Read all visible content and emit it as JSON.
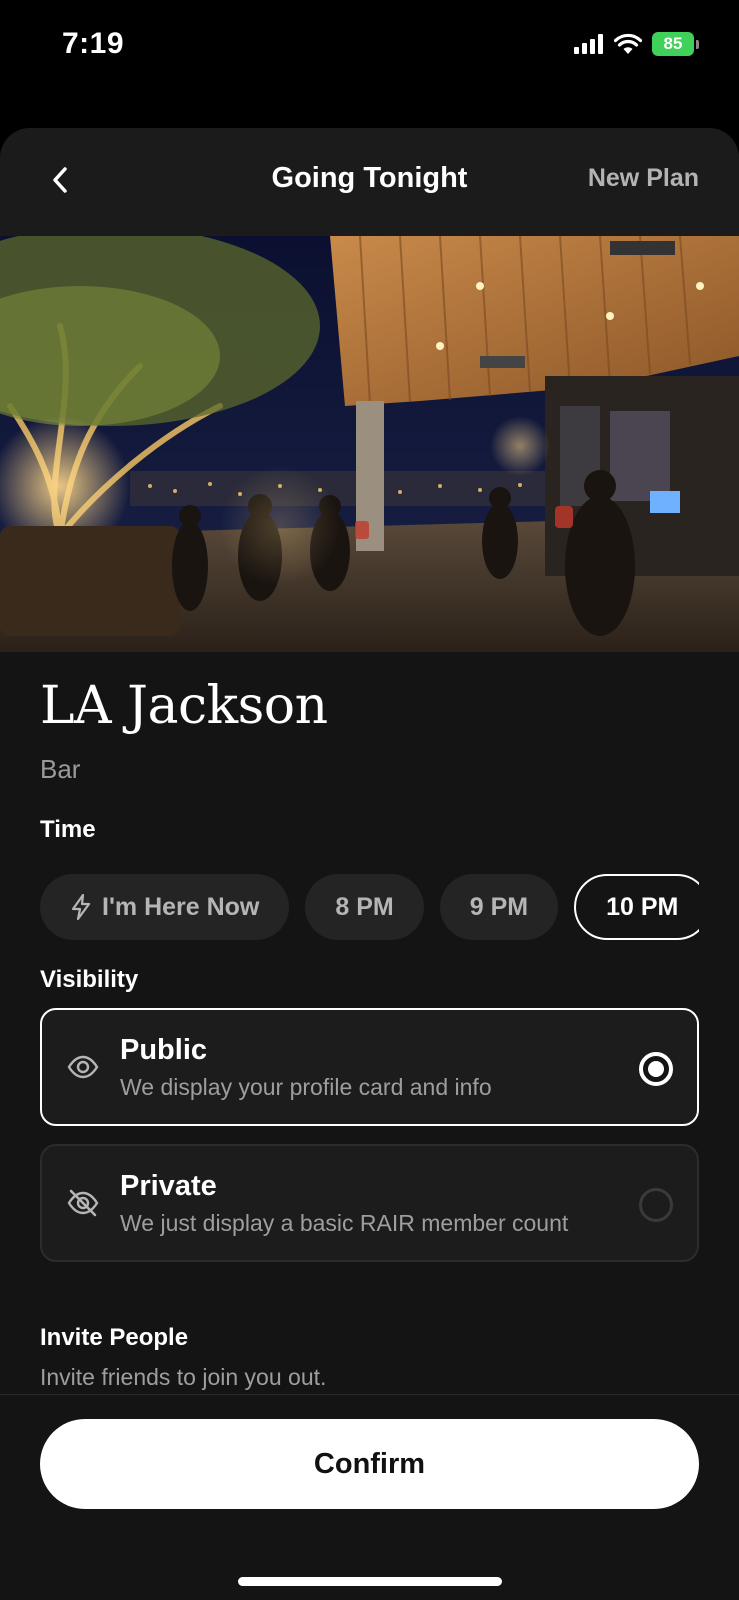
{
  "status_bar": {
    "time": "7:19",
    "battery": "85",
    "icons": [
      "cellular-signal-icon",
      "wifi-icon",
      "battery-icon"
    ]
  },
  "header": {
    "title": "Going Tonight",
    "action_label": "New Plan",
    "back_icon": "chevron-left-icon"
  },
  "venue": {
    "name": "LA Jackson",
    "type": "Bar",
    "photo": "rooftop-bar-night-photo"
  },
  "time": {
    "label": "Time",
    "options": [
      {
        "label": "I'm Here Now",
        "icon": "lightning-icon",
        "selected": false
      },
      {
        "label": "8 PM",
        "selected": false
      },
      {
        "label": "9 PM",
        "selected": false
      },
      {
        "label": "10 PM",
        "selected": true
      }
    ]
  },
  "visibility": {
    "label": "Visibility",
    "options": [
      {
        "title": "Public",
        "description": "We display your profile card and info",
        "icon": "eye-icon",
        "selected": true
      },
      {
        "title": "Private",
        "description": "We just display a basic RAIR member count",
        "icon": "eye-off-icon",
        "selected": false
      }
    ]
  },
  "invite": {
    "title": "Invite People",
    "description": "Invite friends to join you out."
  },
  "footer": {
    "confirm_label": "Confirm"
  },
  "colors": {
    "background": "#141414",
    "header": "#1b1b1b",
    "chip": "#242424",
    "battery": "#3fd15a",
    "accent": "#ffffff"
  }
}
